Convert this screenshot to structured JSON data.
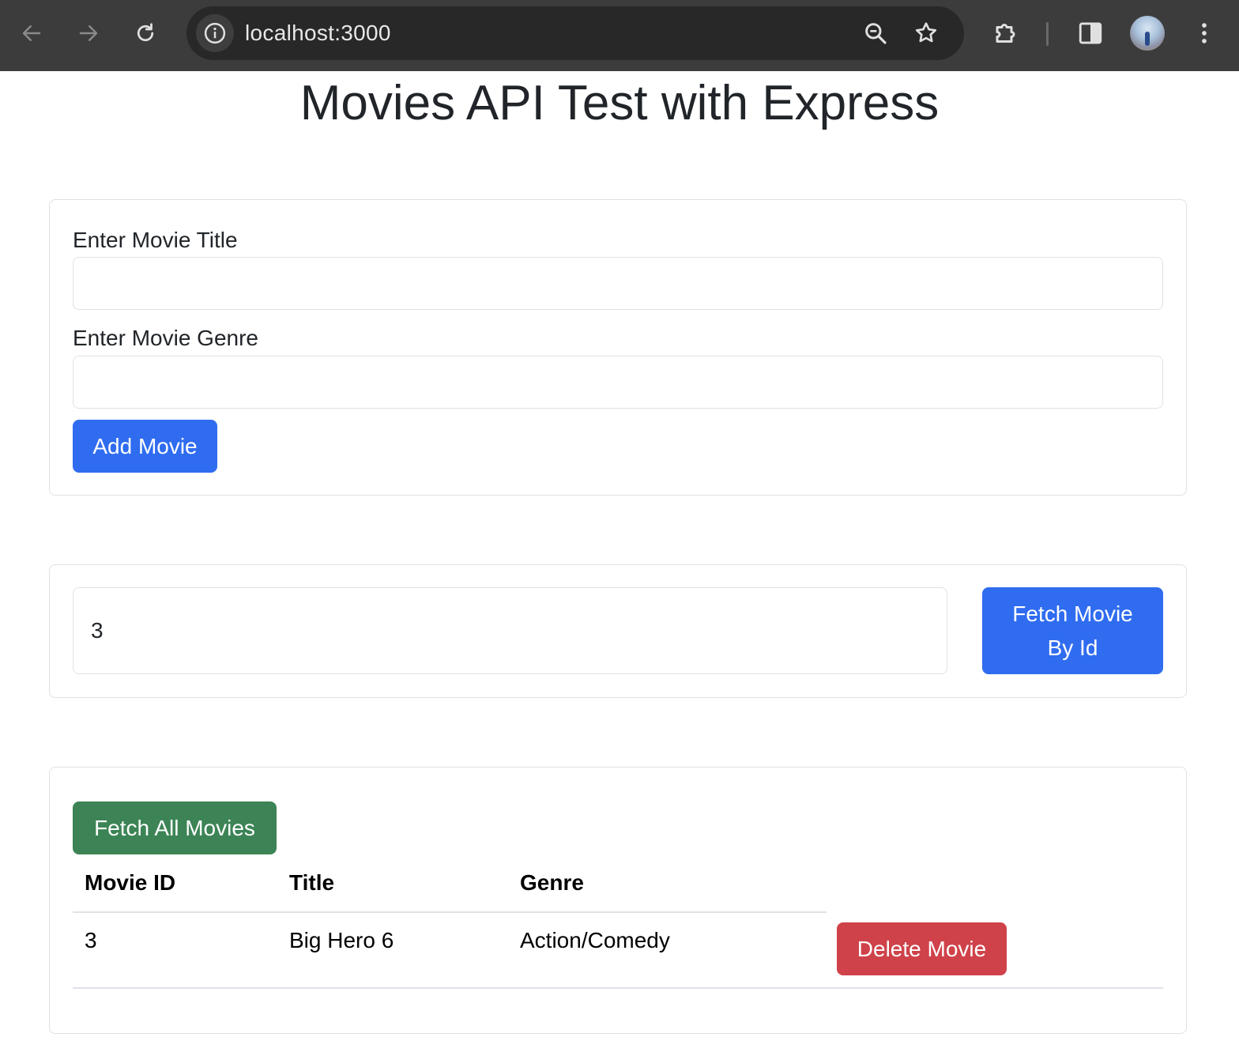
{
  "browser": {
    "url": "localhost:3000"
  },
  "page": {
    "title": "Movies API Test with Express"
  },
  "add_form": {
    "title_label": "Enter Movie Title",
    "title_value": "",
    "genre_label": "Enter Movie Genre",
    "genre_value": "",
    "add_button": "Add Movie"
  },
  "fetch_by_id": {
    "id_value": "3",
    "button_line1": "Fetch Movie",
    "button_line2": "By Id"
  },
  "list": {
    "fetch_all_button": "Fetch All Movies",
    "columns": [
      "Movie ID",
      "Title",
      "Genre"
    ],
    "rows": [
      {
        "id": "3",
        "title": "Big Hero 6",
        "genre": "Action/Comedy",
        "delete_button": "Delete Movie"
      }
    ]
  },
  "colors": {
    "primary": "#2f6cf0",
    "success": "#3c8455",
    "danger": "#cf4249",
    "chrome_bg": "#3c3c3c"
  }
}
